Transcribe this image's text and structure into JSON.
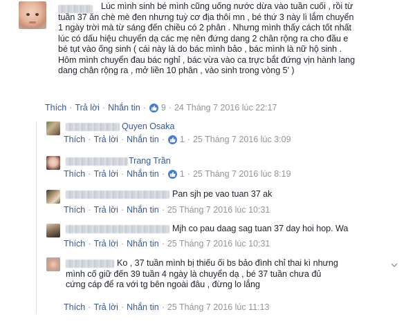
{
  "main_comment": {
    "text_lines": [
      "Lúc mình sinh bé mình cũng uống nước dừa vào tuần cuối , rồi từ",
      "tuần 37 ăn chè mè đen nhưng tuỳ cơ địa thôi mn , bé thứ 3 này lì lắm chuyển",
      "1 ngày trời mà từ sáng đến chiều có 2 phân . Nhưng mình thấy cách tốt nhất",
      "lúc có dấu hiệu chuyển dạ các mẹ nên đứng dang 2 chân rộng ra cho đầu e",
      "bé tụt vào ống sinh ( cái này là do bác mình bảo , bác mình là nữ hộ sinh .",
      "Hôm mình chuyển đau bác nghỉ , bác vừa vào ca trực bắt đứng vịn hành lang",
      "dang chân rộng ra , mở liền 10 phân , vào sinh trong vòng 5' )"
    ],
    "actions": {
      "like": "Thích",
      "reply": "Trả lời",
      "message": "Nhắn tin",
      "likes": "9",
      "time": "24 Tháng 7 2016 lúc 22:17"
    }
  },
  "replies": [
    {
      "name": "Quyen Osaka",
      "text": "",
      "actions": {
        "like": "Thích",
        "reply": "Trả lời",
        "message": "Nhắn tin",
        "likes": "1",
        "time": "25 Tháng 7 2016 lúc 3:09"
      }
    },
    {
      "name": "Trang Trần",
      "text": "",
      "actions": {
        "like": "Thích",
        "reply": "Trả lời",
        "message": "Nhắn tin",
        "likes": "1",
        "time": "25 Tháng 7 2016 lúc 8:19"
      }
    },
    {
      "name": "",
      "text": "Pan sjh pe vao tuan 37 ak",
      "actions": {
        "like": "Thích",
        "reply": "Trả lời",
        "message": "Nhắn tin",
        "likes": "",
        "time": "25 Tháng 7 2016 lúc 10:31"
      }
    },
    {
      "name": "",
      "text": "Mjh co pau daag sag tuan 37 day hoi hop. Wa",
      "actions": {
        "like": "Thích",
        "reply": "Trả lời",
        "message": "Nhắn tin",
        "likes": "",
        "time": "25 Tháng 7 2016 lúc 10:31"
      }
    },
    {
      "name": "",
      "text_lines": [
        "Ko , 37 tuần mình bị thiếu ối bs bảo đình chỉ thai kì nhưng",
        "mình cố giữ đến 39 tuần 4 ngày là chuyển dạ , bé 37 tuần chưa đủ",
        "cứng cáp để ra với tg bên ngoài đâu , đừng lo lắng"
      ],
      "actions": {
        "like": "Thích",
        "reply": "Trả lời",
        "message": "Nhắn tin",
        "likes": "",
        "time": "25 Tháng 7 2016 lúc 11:13"
      }
    }
  ],
  "separator": "·",
  "colors": {
    "link": "#365899",
    "meta": "#90949c",
    "text": "#1d2129",
    "like_badge": "#4a7bd0"
  }
}
